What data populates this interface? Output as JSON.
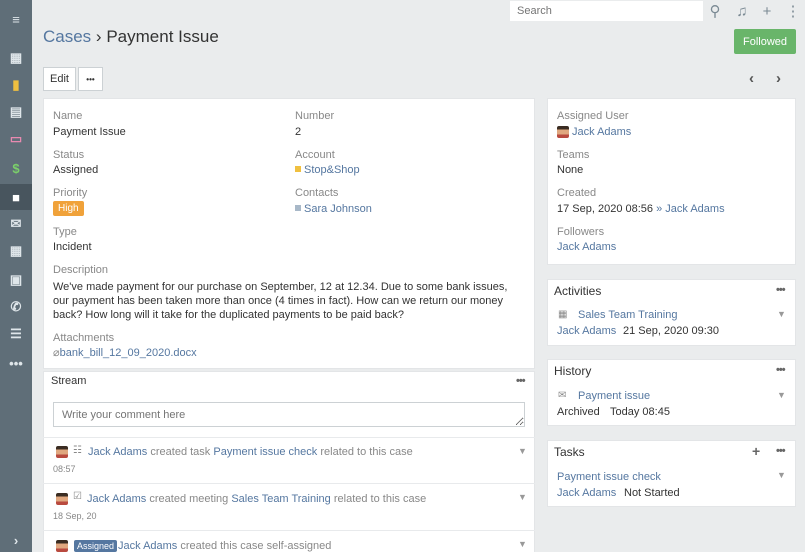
{
  "topbar": {
    "search_placeholder": "Search"
  },
  "header": {
    "breadcrumb": "Cases",
    "separator": "›",
    "title": "Payment Issue",
    "followed_label": "Followed",
    "edit_label": "Edit",
    "more_label": "•••"
  },
  "details": {
    "name_label": "Name",
    "name_value": "Payment Issue",
    "number_label": "Number",
    "number_value": "2",
    "status_label": "Status",
    "status_value": "Assigned",
    "account_label": "Account",
    "account_value": "Stop&Shop",
    "priority_label": "Priority",
    "priority_value": "High",
    "contacts_label": "Contacts",
    "contacts_value": "Sara Johnson",
    "type_label": "Type",
    "type_value": "Incident",
    "description_label": "Description",
    "description_value": "We've made payment for our purchase on September, 12 at 12.34. Due to some bank issues, our payment has been taken more than once (4 times in fact). How can we return our money back? How long will it take for the duplicated payments to be paid back?",
    "attachments_label": "Attachments",
    "attachment_file": "bank_bill_12_09_2020.docx"
  },
  "stream": {
    "title": "Stream",
    "comment_placeholder": "Write your comment here",
    "entries": [
      {
        "user": "Jack Adams",
        "action": "created task",
        "target": "Payment issue check",
        "suffix": "related to this case",
        "time": "08:57"
      },
      {
        "user": "Jack Adams",
        "action": "created meeting",
        "target": "Sales Team Training",
        "suffix": "related to this case",
        "time": "18 Sep, 20"
      },
      {
        "badge": "Assigned",
        "user": "Jack Adams",
        "action": "created this case self-assigned"
      }
    ]
  },
  "side": {
    "assigned_user_label": "Assigned User",
    "assigned_user_value": "Jack Adams",
    "teams_label": "Teams",
    "teams_value": "None",
    "created_label": "Created",
    "created_date": "17 Sep, 2020 08:56",
    "created_by": "» Jack Adams",
    "followers_label": "Followers",
    "followers_value": "Jack Adams"
  },
  "activities": {
    "title": "Activities",
    "item_name": "Sales Team Training",
    "item_user": "Jack Adams",
    "item_date": "21 Sep, 2020 09:30"
  },
  "history": {
    "title": "History",
    "item_name": "Payment issue",
    "item_status": "Archived",
    "item_date": "Today 08:45"
  },
  "tasks": {
    "title": "Tasks",
    "item_name": "Payment issue check",
    "item_user": "Jack Adams",
    "item_status": "Not Started"
  },
  "colors": {
    "sidebar": "#5f6e78",
    "link": "#5577a0",
    "followed": "#69b56a",
    "priority_high": "#f0a23a"
  }
}
